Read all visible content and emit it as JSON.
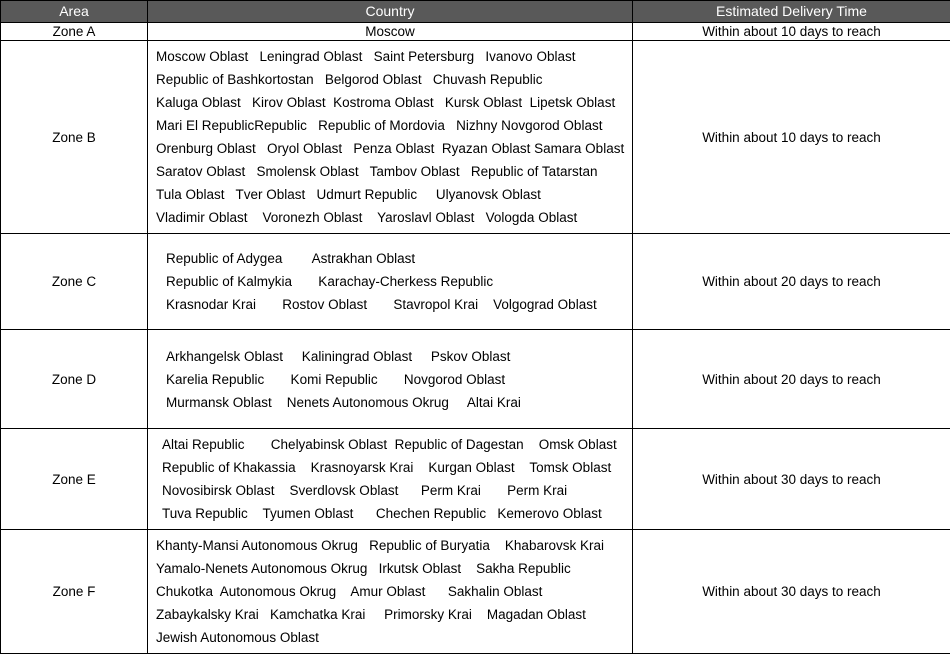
{
  "table": {
    "headers": {
      "area": "Area",
      "country": "Country",
      "time": "Estimated Delivery Time"
    },
    "header_bg": "#595959",
    "header_fg": "#ffffff",
    "border_color": "#000000",
    "rows": [
      {
        "area": "Zone A",
        "time": "Within about 10 days to reach",
        "country_lines": [
          "Moscow"
        ]
      },
      {
        "area": "Zone B",
        "time": "Within about 10 days to reach",
        "country_lines": [
          "Moscow Oblast   Leningrad Oblast   Saint Petersburg   Ivanovo Oblast",
          "Republic of Bashkortostan   Belgorod Oblast   Chuvash Republic",
          "Kaluga Oblast   Kirov Oblast  Kostroma Oblast   Kursk Oblast  Lipetsk Oblast",
          "Mari El RepublicRepublic   Republic of Mordovia   Nizhny Novgorod Oblast",
          "Orenburg Oblast   Oryol Oblast   Penza Oblast  Ryazan Oblast Samara Oblast",
          "Saratov Oblast   Smolensk Oblast   Tambov Oblast   Republic of Tatarstan",
          "Tula Oblast   Tver Oblast   Udmurt Republic     Ulyanovsk Oblast",
          "Vladimir Oblast    Voronezh Oblast    Yaroslavl Oblast   Vologda Oblast"
        ]
      },
      {
        "area": "Zone C",
        "time": "Within about 20 days to reach",
        "country_lines": [
          "Republic of Adygea        Astrakhan Oblast",
          "Republic of Kalmykia       Karachay-Cherkess Republic",
          "Krasnodar Krai       Rostov Oblast       Stavropol Krai    Volgograd Oblast"
        ]
      },
      {
        "area": "Zone D",
        "time": "Within about 20 days to reach",
        "country_lines": [
          "Arkhangelsk Oblast     Kaliningrad Oblast     Pskov Oblast",
          "Karelia Republic       Komi Republic       Novgorod Oblast",
          "Murmansk Oblast    Nenets Autonomous Okrug     Altai Krai"
        ]
      },
      {
        "area": "Zone E",
        "time": "Within about 30 days to reach",
        "country_lines": [
          "Altai Republic       Chelyabinsk Oblast  Republic of Dagestan    Omsk Oblast",
          "Republic of Khakassia    Krasnoyarsk Krai    Kurgan Oblast    Tomsk Oblast",
          "Novosibirsk Oblast    Sverdlovsk Oblast      Perm Krai       Perm Krai",
          "Tuva Republic    Tyumen Oblast      Chechen Republic   Kemerovo Oblast"
        ]
      },
      {
        "area": "Zone F",
        "time": "Within about 30 days to reach",
        "country_lines": [
          "Khanty-Mansi Autonomous Okrug   Republic of Buryatia    Khabarovsk Krai",
          "Yamalo-Nenets Autonomous Okrug   Irkutsk Oblast    Sakha Republic",
          "Chukotka  Autonomous Okrug    Amur Oblast      Sakhalin Oblast",
          "Zabaykalsky Krai   Kamchatka Krai     Primorsky Krai    Magadan Oblast",
          "Jewish Autonomous Oblast"
        ]
      }
    ]
  }
}
